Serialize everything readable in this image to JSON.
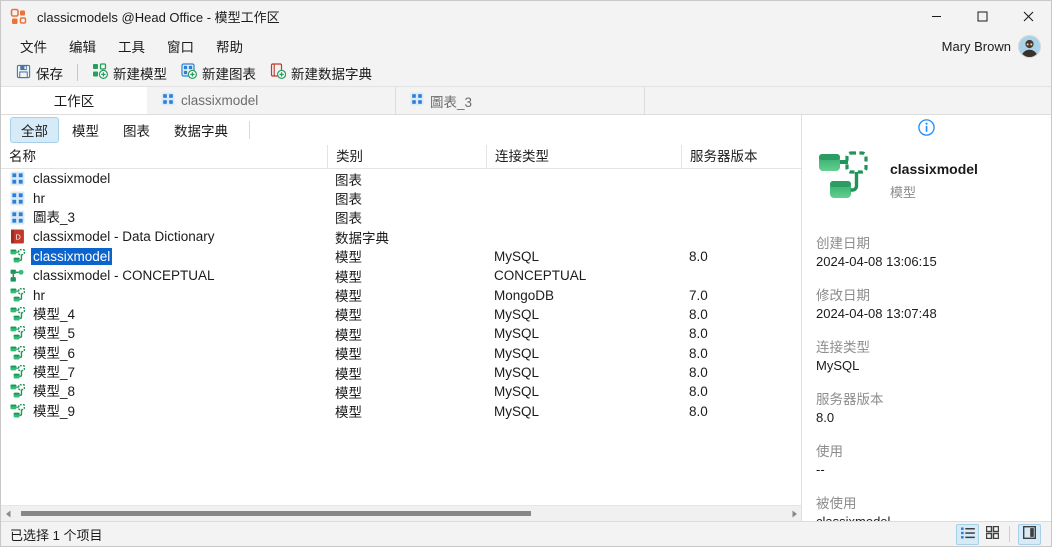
{
  "window": {
    "title": "classicmodels @Head Office - 模型工作区",
    "app_icon": "app-logo-icon",
    "minimize": "–",
    "maximize": "☐",
    "close": "✕"
  },
  "menubar": {
    "items": [
      {
        "label": "文件",
        "name": "menu-file"
      },
      {
        "label": "编辑",
        "name": "menu-edit"
      },
      {
        "label": "工具",
        "name": "menu-tools"
      },
      {
        "label": "窗口",
        "name": "menu-window"
      },
      {
        "label": "帮助",
        "name": "menu-help"
      }
    ],
    "user_name": "Mary Brown"
  },
  "toolbar": {
    "save_label": "保存",
    "new_model_label": "新建模型",
    "new_diagram_label": "新建图表",
    "new_dictionary_label": "新建数据字典"
  },
  "tabs": [
    {
      "label": "工作区",
      "active": true,
      "icon": null
    },
    {
      "label": "classixmodel",
      "active": false,
      "icon": "diagram-icon"
    },
    {
      "label": "圖表_3",
      "active": false,
      "icon": "diagram-icon"
    }
  ],
  "filters": [
    {
      "label": "全部",
      "active": true
    },
    {
      "label": "模型",
      "active": false
    },
    {
      "label": "图表",
      "active": false
    },
    {
      "label": "数据字典",
      "active": false
    }
  ],
  "table": {
    "columns": [
      "名称",
      "类别",
      "连接类型",
      "服务器版本"
    ],
    "sort_column_indicator": "⌃",
    "rows": [
      {
        "name": "classixmodel",
        "category": "图表",
        "connection": "",
        "version": "",
        "icon": "diagram-icon",
        "selected": false
      },
      {
        "name": "hr",
        "category": "图表",
        "connection": "",
        "version": "",
        "icon": "diagram-icon",
        "selected": false
      },
      {
        "name": "圖表_3",
        "category": "图表",
        "connection": "",
        "version": "",
        "icon": "diagram-icon",
        "selected": false
      },
      {
        "name": "classixmodel - Data Dictionary",
        "category": "数据字典",
        "connection": "",
        "version": "",
        "icon": "dictionary-icon",
        "selected": false
      },
      {
        "name": "classixmodel",
        "category": "模型",
        "connection": "MySQL",
        "version": "8.0",
        "icon": "model-icon",
        "selected": true
      },
      {
        "name": "classixmodel - CONCEPTUAL",
        "category": "模型",
        "connection": "CONCEPTUAL",
        "version": "",
        "icon": "conceptual-model-icon",
        "selected": false
      },
      {
        "name": "hr",
        "category": "模型",
        "connection": "MongoDB",
        "version": "7.0",
        "icon": "model-icon",
        "selected": false
      },
      {
        "name": "模型_4",
        "category": "模型",
        "connection": "MySQL",
        "version": "8.0",
        "icon": "model-icon",
        "selected": false
      },
      {
        "name": "模型_5",
        "category": "模型",
        "connection": "MySQL",
        "version": "8.0",
        "icon": "model-icon",
        "selected": false
      },
      {
        "name": "模型_6",
        "category": "模型",
        "connection": "MySQL",
        "version": "8.0",
        "icon": "model-icon",
        "selected": false
      },
      {
        "name": "模型_7",
        "category": "模型",
        "connection": "MySQL",
        "version": "8.0",
        "icon": "model-icon",
        "selected": false
      },
      {
        "name": "模型_8",
        "category": "模型",
        "connection": "MySQL",
        "version": "8.0",
        "icon": "model-icon",
        "selected": false
      },
      {
        "name": "模型_9",
        "category": "模型",
        "connection": "MySQL",
        "version": "8.0",
        "icon": "model-icon",
        "selected": false
      }
    ]
  },
  "details": {
    "info_icon": "info-icon",
    "item_icon": "model-icon-large",
    "title": "classixmodel",
    "subtitle": "模型",
    "fields": [
      {
        "label": "创建日期",
        "value": "2024-04-08 13:06:15"
      },
      {
        "label": "修改日期",
        "value": "2024-04-08 13:07:48"
      },
      {
        "label": "连接类型",
        "value": "MySQL"
      },
      {
        "label": "服务器版本",
        "value": "8.0"
      },
      {
        "label": "使用",
        "value": "--"
      },
      {
        "label": "被使用",
        "value": "classixmodel"
      }
    ]
  },
  "statusbar": {
    "text": "已选择 1 个项目",
    "view_buttons": [
      {
        "name": "list-view-button",
        "icon": "list-view-icon",
        "active": true
      },
      {
        "name": "grid-view-button",
        "icon": "grid-view-icon",
        "active": false
      },
      {
        "name": "details-panel-toggle",
        "icon": "side-panel-icon",
        "active": true
      }
    ]
  },
  "colors": {
    "selection_blue": "#0b63ce",
    "chip_active_bg": "#d6eaf8",
    "chip_active_border": "#a8cfe8",
    "model_green": "#22a05c",
    "diagram_blue": "#2b7fd4",
    "dictionary_red": "#c0392b",
    "info_blue": "#1a8cff",
    "chrome_gray": "#f3f3f3"
  }
}
